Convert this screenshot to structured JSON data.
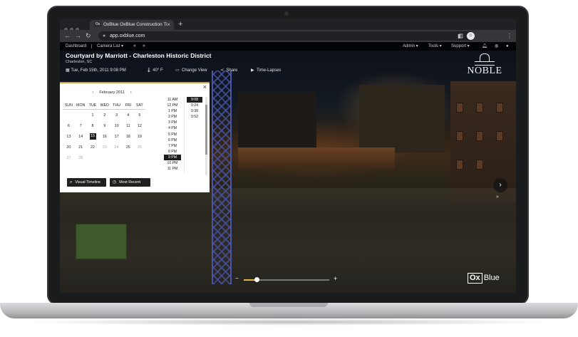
{
  "browser": {
    "tab_title": "OxBlue OxBlue Construction Ti",
    "tab_favicon": "Ox",
    "tab_close": "×",
    "new_tab": "+",
    "url": "app.oxblue.com",
    "icons": [
      "back-icon",
      "forward-icon",
      "reload-icon",
      "lock-icon",
      "key-icon",
      "star-icon",
      "sidebar-icon",
      "profile-icon",
      "menu-icon"
    ]
  },
  "sitebar": {
    "dashboard": "Dashboard",
    "camera_list": "Camera List",
    "admin": "Admin",
    "tools": "Tools",
    "support": "Support"
  },
  "project": {
    "title": "Courtyard by Marriott - Charleston Historic District",
    "location": "Charleston, SC"
  },
  "toolbar": {
    "date": "Tue, Feb 15th, 2011 9:08 PM",
    "temperature": "40° F",
    "change_view": "Change View",
    "share": "Share",
    "time_lapses": "Time-Lapses"
  },
  "logo": {
    "noble": "NOBLE",
    "oxblue_ox": "Ox",
    "oxblue_blue": "Blue"
  },
  "calendar": {
    "month": "February 2011",
    "prev": "‹",
    "next": "›",
    "weekdays": [
      "SUN",
      "MON",
      "TUE",
      "WED",
      "THU",
      "FRI",
      "SAT"
    ],
    "weeks": [
      [
        "",
        "",
        "1",
        "2",
        "3",
        "4",
        "5"
      ],
      [
        "6",
        "7",
        "8",
        "9",
        "10",
        "11",
        "12"
      ],
      [
        "13",
        "14",
        "15",
        "16",
        "17",
        "18",
        "19"
      ],
      [
        "20",
        "21",
        "22",
        "23",
        "24",
        "25",
        "26"
      ],
      [
        "27",
        "28",
        "",
        "",
        "",
        "",
        ""
      ]
    ],
    "selected_day": "15",
    "hours": [
      "11 AM",
      "12 PM",
      "1 PM",
      "2 PM",
      "3 PM",
      "4 PM",
      "5 PM",
      "6 PM",
      "7 PM",
      "8 PM",
      "9 PM",
      "10 PM",
      "11 PM"
    ],
    "selected_hour": "9 PM",
    "minutes": [
      "9:08",
      "9:24",
      "9:38",
      "9:52"
    ],
    "selected_minute": "9:08",
    "visual_timeline": "Visual Timeline",
    "most_recent": "Most Recent",
    "close": "×"
  },
  "viewer": {
    "zoom_minus": "−",
    "zoom_plus": "+",
    "zoom_level": 0.15,
    "next": "›",
    "fast_forward": "»"
  }
}
